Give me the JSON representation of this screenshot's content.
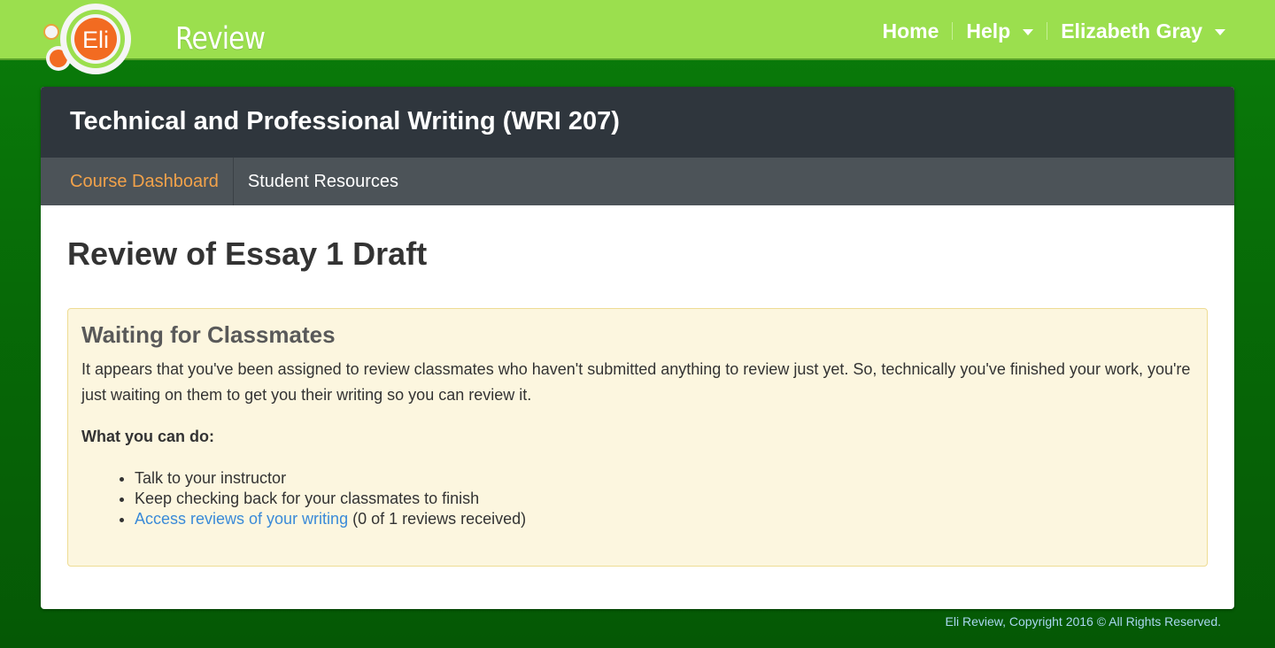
{
  "app": {
    "logo_text": "Review",
    "logo_badge": "Eli"
  },
  "nav": {
    "home": "Home",
    "help": "Help",
    "user": "Elizabeth Gray"
  },
  "course": {
    "title": "Technical and Professional Writing (WRI 207)",
    "tabs": [
      {
        "label": "Course Dashboard",
        "active": true
      },
      {
        "label": "Student Resources",
        "active": false
      }
    ]
  },
  "page": {
    "title": "Review of Essay 1 Draft"
  },
  "notice": {
    "title": "Waiting for Classmates",
    "body": "It appears that you've been assigned to review classmates who haven't submitted anything to review just yet. So, technically you've finished your work, you're just waiting on them to get you their writing so you can review it.",
    "subtitle": "What you can do:",
    "items": [
      {
        "text": "Talk to your instructor"
      },
      {
        "text": "Keep checking back for your classmates to finish"
      },
      {
        "link": "Access reviews of your writing",
        "suffix": " (0 of 1 reviews received)"
      }
    ]
  },
  "footer": {
    "text": "Eli Review, Copyright 2016 © All Rights Reserved."
  },
  "colors": {
    "topbar": "#9bdf4e",
    "background": "#0a7d0a",
    "course_header": "#2f363d",
    "course_nav": "#4c5358",
    "active_tab": "#f2a24a",
    "notice_bg": "#fcf6df",
    "link": "#3a8ad8",
    "logo_orange": "#f26b21"
  }
}
